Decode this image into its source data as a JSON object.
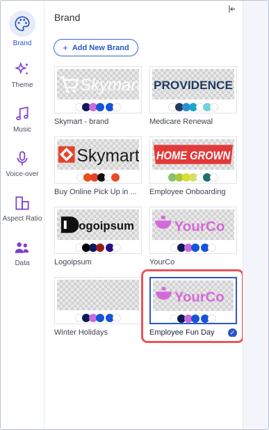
{
  "rail": {
    "items": [
      {
        "label": "Brand",
        "icon": "palette-icon",
        "active": true
      },
      {
        "label": "Theme",
        "icon": "sparkles-icon"
      },
      {
        "label": "Music",
        "icon": "music-note-icon"
      },
      {
        "label": "Voice-over",
        "icon": "microphone-icon"
      },
      {
        "label": "Aspect Ratio",
        "icon": "aspect-ratio-icon"
      },
      {
        "label": "Data",
        "icon": "users-data-icon"
      }
    ]
  },
  "panel": {
    "title": "Brand",
    "add_button": "Add New Brand"
  },
  "brands": [
    {
      "name": "Skymart - brand",
      "logo_text": "Skymart",
      "swatches": [
        "#ffffff",
        "#0c1a5c",
        "#c86bdc",
        "#1553d9",
        "gap",
        "#1553d9",
        "#ffffff"
      ]
    },
    {
      "name": "Medicare Renewal",
      "logo_text": "PROVIDENCE",
      "swatches": [
        "#ffffff",
        "#1f3b64",
        "#2b8fd6",
        "#1aa7c9",
        "#ffffff",
        "#6fd2e0",
        "#ffffff"
      ]
    },
    {
      "name": "Buy Online Pick Up in ...",
      "logo_text": "Skymart",
      "swatches": [
        "#ffffff",
        "#ea4c1b",
        "#e5432a",
        "#111111",
        "#ffffff",
        "#e84a2c"
      ]
    },
    {
      "name": "Employee Onboarding",
      "logo_text": "HOME GROWN",
      "swatches": [
        "#8ac26a",
        "#a7c93c",
        "#d8e028",
        "#d7dd66",
        "#ffffff",
        "#1f6f73",
        "#ffffff"
      ]
    },
    {
      "name": "Logoipsum",
      "logo_text": "logoipsum",
      "swatches": [
        "#ffffff",
        "#000000",
        "#0c1a5c",
        "#9a1a1a",
        "gap",
        "#2b0d85",
        "#ffffff"
      ]
    },
    {
      "name": "YourCo",
      "logo_text": "YourCo",
      "swatches": [
        "#ffffff",
        "#0c1a5c",
        "#c86bdc",
        "#1553d9",
        "gap",
        "#1553d9",
        "#ffffff"
      ]
    },
    {
      "name": "Winter Holidays",
      "logo_text": "",
      "swatches": [
        "#ffffff",
        "#0c1a5c",
        "#c86bdc",
        "#1553d9",
        "gap",
        "#1553d9",
        "#ffffff"
      ]
    },
    {
      "name": "Employee Fun Day",
      "logo_text": "YourCo",
      "selected": true,
      "swatches": [
        "#ffffff",
        "#0c1a5c",
        "#c86bdc",
        "#1553d9",
        "gap",
        "#1553d9",
        "#ffffff"
      ]
    }
  ],
  "colors": {
    "accent": "#2a56c6",
    "highlight": "#e8545a"
  }
}
